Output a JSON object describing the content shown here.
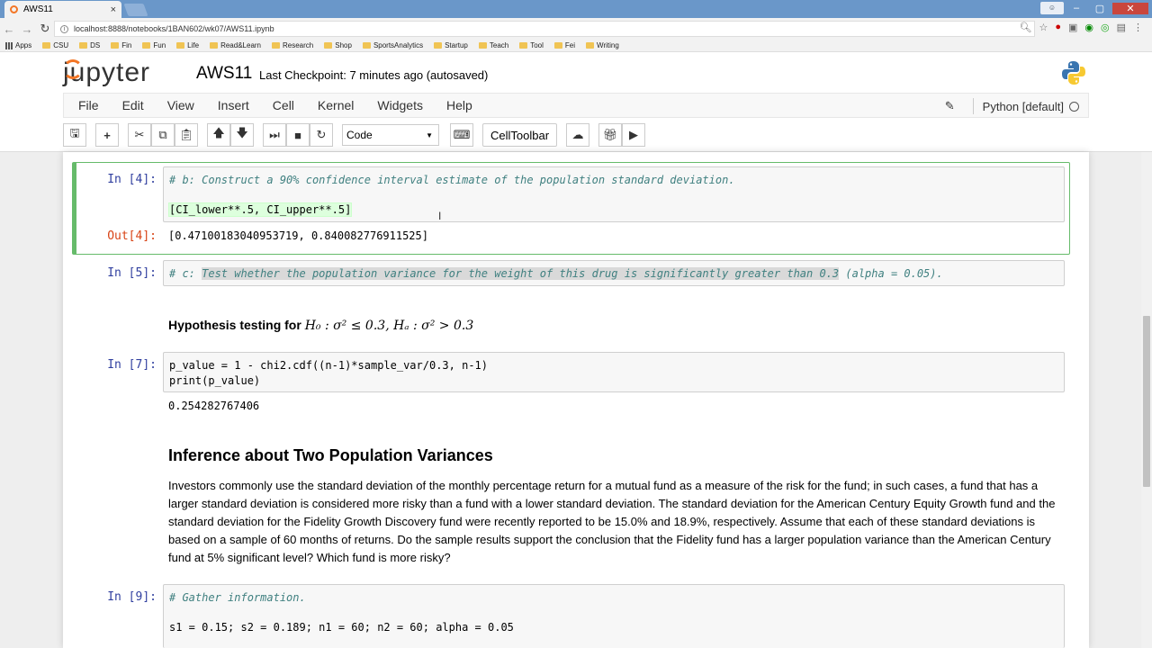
{
  "browser": {
    "tab_title": "AWS11",
    "url": "localhost:8888/notebooks/1BAN602/wk07/AWS11.ipynb",
    "bookmarks": [
      "Apps",
      "CSU",
      "DS",
      "Fin",
      "Fun",
      "Life",
      "Read&Learn",
      "Research",
      "Shop",
      "SportsAnalytics",
      "Startup",
      "Teach",
      "Tool",
      "Fei",
      "Writing"
    ]
  },
  "jupyter": {
    "logo_text": "jupyter",
    "notebook_name": "AWS11",
    "checkpoint": "Last Checkpoint: 7 minutes ago (autosaved)",
    "menu": [
      "File",
      "Edit",
      "View",
      "Insert",
      "Cell",
      "Kernel",
      "Widgets",
      "Help"
    ],
    "kernel_name": "Python [default]",
    "cell_type": "Code",
    "celltoolbar_label": "CellToolbar"
  },
  "cells": {
    "c4": {
      "in_prompt": "In [4]:",
      "comment": "# b: Construct a 90% confidence interval estimate of the population standard deviation.",
      "code": "[CI_lower**.5, CI_upper**.5]",
      "out_prompt": "Out[4]:",
      "output": "[0.47100183040953719, 0.840082776911525]"
    },
    "c5": {
      "in_prompt": "In [5]:",
      "comment_prefix": "# c: ",
      "comment_selected": "Test whether the population variance for the weight of this drug is significantly greater than 0.3",
      "comment_suffix": " (alpha = 0.05)."
    },
    "hyp": {
      "label": "Hypothesis testing for ",
      "math": "H₀ : σ² ≤ 0.3, Hₐ : σ² > 0.3"
    },
    "c7": {
      "in_prompt": "In [7]:",
      "line1": "p_value = 1 - chi2.cdf((n-1)*sample_var/0.3, n-1)",
      "line2": "print(p_value)",
      "output": "0.254282767406"
    },
    "md": {
      "heading": "Inference about Two Population Variances",
      "paragraph": "Investors commonly use the standard deviation of the monthly percentage return for a mutual fund as a measure of the risk for the fund; in such cases, a fund that has a larger standard deviation is considered more risky than a fund with a lower standard deviation. The standard deviation for the American Century Equity Growth fund and the standard deviation for the Fidelity Growth Discovery fund were recently reported to be 15.0% and 18.9%, respectively. Assume that each of these standard deviations is based on a sample of 60 months of returns. Do the sample results support the conclusion that the Fidelity fund has a larger population variance than the American Century fund at 5% significant level? Which fund is more risky?"
    },
    "c9": {
      "in_prompt": "In [9]:",
      "comment": "# Gather information.",
      "code": "s1 = 0.15; s2 = 0.189; n1 = 60; n2 = 60; alpha = 0.05"
    }
  }
}
